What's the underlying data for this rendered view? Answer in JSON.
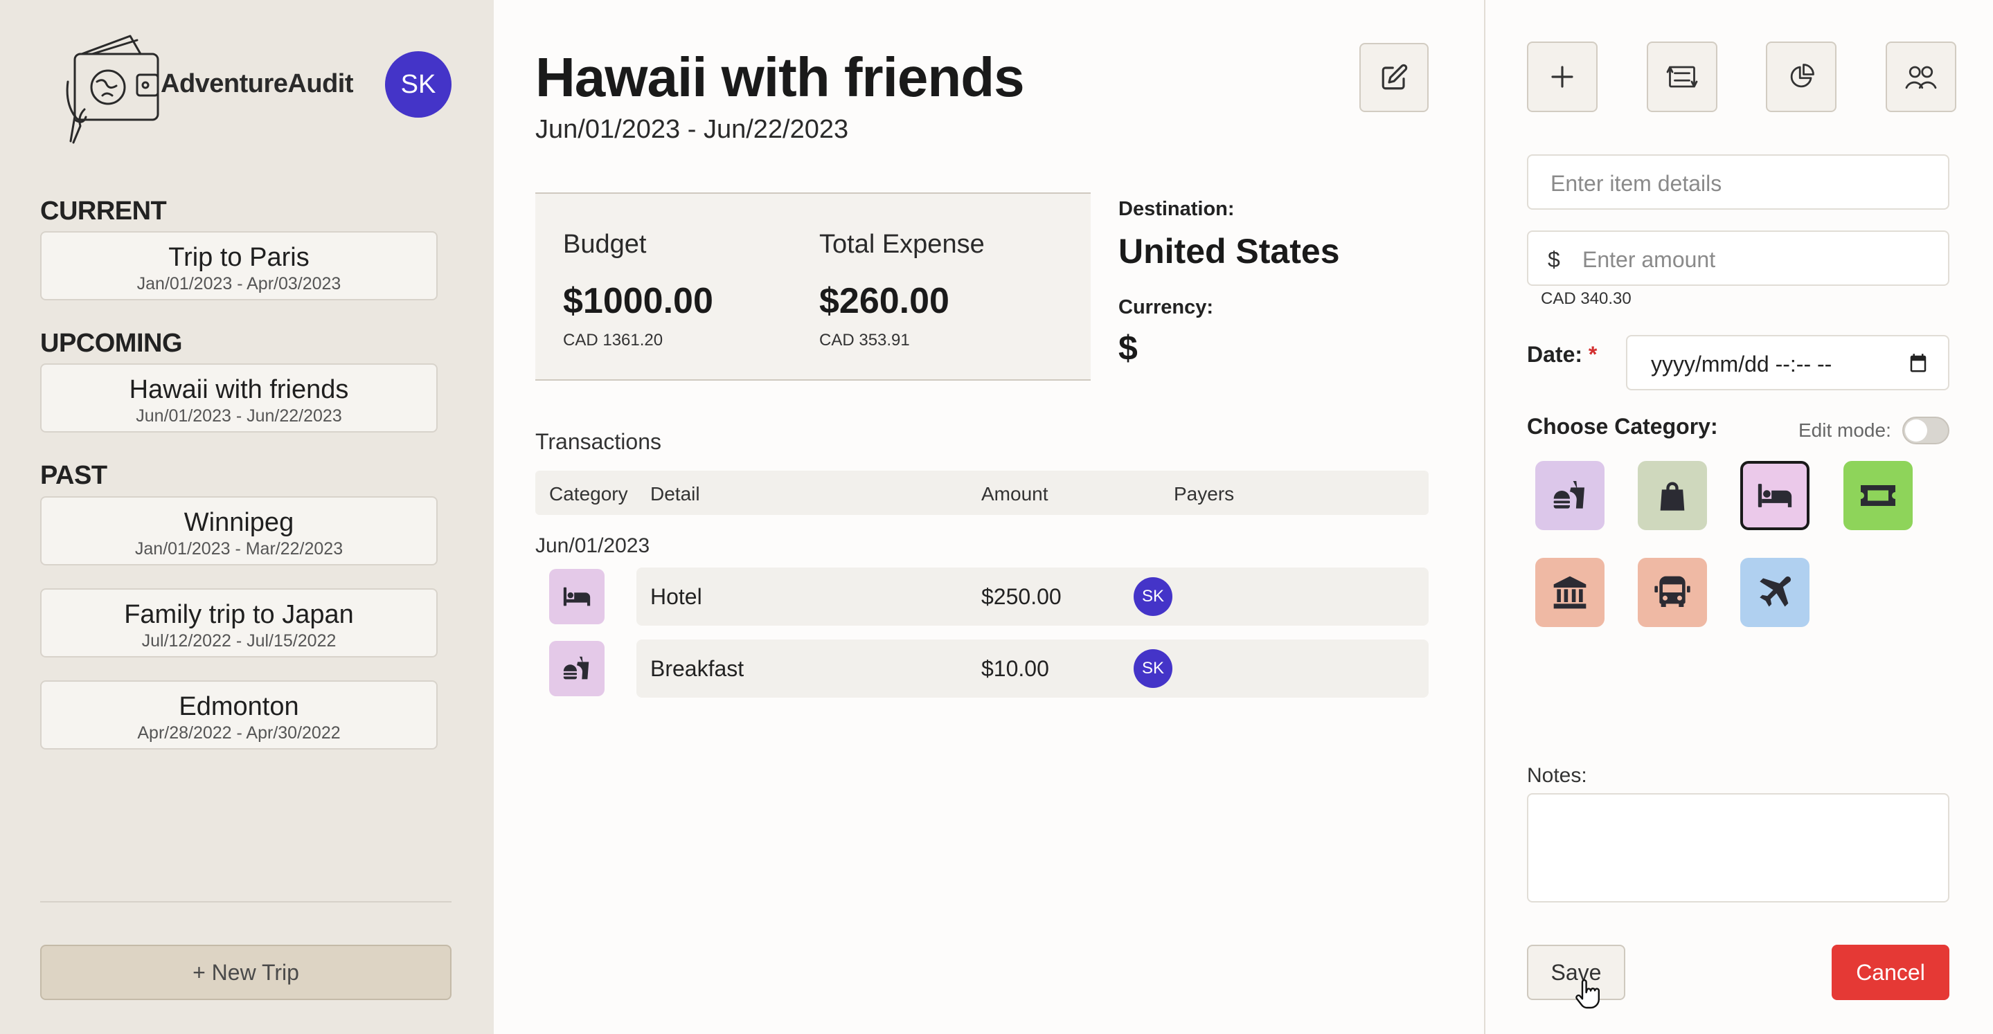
{
  "app": {
    "brand": "AdventureAudit",
    "user_initials": "SK"
  },
  "sidebar": {
    "current_heading": "CURRENT",
    "upcoming_heading": "UPCOMING",
    "past_heading": "PAST",
    "current": [
      {
        "name": "Trip to Paris",
        "dates": "Jan/01/2023 - Apr/03/2023"
      }
    ],
    "upcoming": [
      {
        "name": "Hawaii with friends",
        "dates": "Jun/01/2023 - Jun/22/2023"
      }
    ],
    "past": [
      {
        "name": "Winnipeg",
        "dates": "Jan/01/2023 - Mar/22/2023"
      },
      {
        "name": "Family trip to Japan",
        "dates": "Jul/12/2022 - Jul/15/2022"
      },
      {
        "name": "Edmonton",
        "dates": "Apr/28/2022 - Apr/30/2022"
      }
    ],
    "new_trip_label": "+ New Trip"
  },
  "trip": {
    "title": "Hawaii with friends",
    "dates": "Jun/01/2023 - Jun/22/2023",
    "budget_label": "Budget",
    "budget_value": "$1000.00",
    "budget_cad": "CAD 1361.20",
    "expense_label": "Total Expense",
    "expense_value": "$260.00",
    "expense_cad": "CAD 353.91",
    "destination_label": "Destination:",
    "destination_value": "United States",
    "currency_label": "Currency:",
    "currency_value": "$"
  },
  "transactions": {
    "title": "Transactions",
    "columns": [
      "Category",
      "Detail",
      "Amount",
      "Payers"
    ],
    "date_group": "Jun/01/2023",
    "rows": [
      {
        "category_icon": "bed-icon",
        "detail": "Hotel",
        "amount": "$250.00",
        "payer": "SK"
      },
      {
        "category_icon": "fast-food-icon",
        "detail": "Breakfast",
        "amount": "$10.00",
        "payer": "SK"
      }
    ]
  },
  "form": {
    "toolbar_icons": [
      "plus-icon",
      "exchange-icon",
      "pie-chart-icon",
      "group-icon"
    ],
    "item_placeholder": "Enter item details",
    "currency_symbol": "$",
    "amount_placeholder": "Enter amount",
    "cad_note": "CAD  340.30",
    "date_label": "Date:",
    "date_required": "*",
    "date_placeholder": "yyyy/mm/dd --:-- --",
    "category_label": "Choose Category:",
    "edit_mode_label": "Edit mode:",
    "edit_mode_on": false,
    "categories": [
      {
        "icon": "fast-food-icon",
        "color": "#dcc7ea"
      },
      {
        "icon": "shopping-bag-icon",
        "color": "#cfd8bd"
      },
      {
        "icon": "bed-icon",
        "color": "#ebc9ea",
        "selected": true
      },
      {
        "icon": "ticket-icon",
        "color": "#8ed45a"
      },
      {
        "icon": "museum-icon",
        "color": "#efb9a4"
      },
      {
        "icon": "bus-icon",
        "color": "#efb9a4"
      },
      {
        "icon": "airplane-icon",
        "color": "#b0d0f0"
      }
    ],
    "notes_label": "Notes:",
    "save_label": "Save",
    "cancel_label": "Cancel"
  },
  "colors": {
    "accent": "#4434c8",
    "cancel": "#e53935",
    "sidebar_bg": "#ebe7e0"
  }
}
